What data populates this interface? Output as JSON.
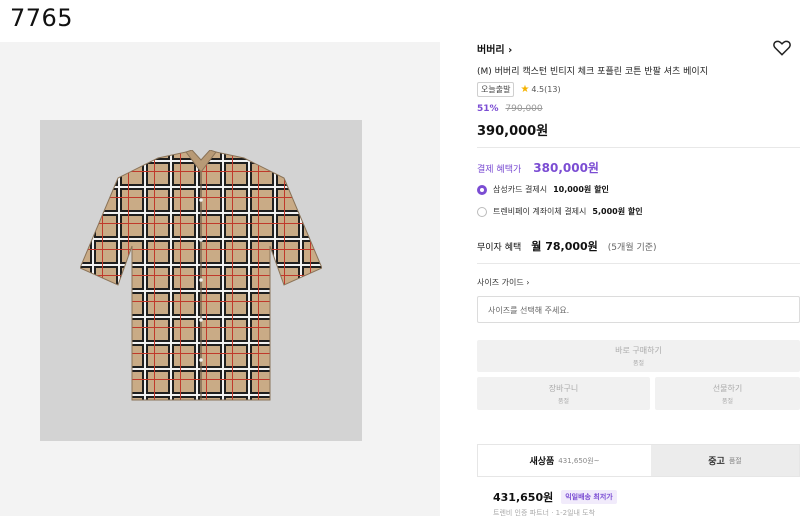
{
  "page_id": "7765",
  "product": {
    "brand": "버버리",
    "brand_arrow": "›",
    "name": "(M) 버버리 캑스턴 빈티지 체크 포플린 코튼 반팔 셔츠 베이지",
    "shipping_tag": "오늘출발",
    "rating": "4.5(13)",
    "discount_rate": "51%",
    "original_price": "790,000",
    "sale_price": "390,000원"
  },
  "benefits": {
    "label": "결제 혜택가",
    "price": "380,000원",
    "options": [
      {
        "text": "삼성카드 결제시",
        "bold": "10,000원 할인",
        "selected": true
      },
      {
        "text": "트렌비페이 계좌이체 결제시",
        "bold": "5,000원 할인",
        "selected": false
      }
    ]
  },
  "installment": {
    "label": "무이자 혜택",
    "amount": "월 78,000원",
    "months": "(5개월 기준)"
  },
  "size": {
    "guide": "사이즈 가이드 ›",
    "placeholder": "사이즈를 선택해 주세요."
  },
  "buttons": {
    "buy": "바로 구매하기",
    "buy_sub": "품절",
    "cart": "장바구니",
    "cart_sub": "품절",
    "gift": "선물하기",
    "gift_sub": "품절"
  },
  "tabs": {
    "new_label": "새상품",
    "new_sub": "431,650원~",
    "used_label": "중고",
    "used_sub": "품절"
  },
  "listing": {
    "price": "431,650원",
    "chip": "익일배송 최저가",
    "note": "트렌비 인증 파트너 · 1-2일내 도착"
  },
  "colors": {
    "accent": "#7b4dd3",
    "star": "#f5b301"
  }
}
